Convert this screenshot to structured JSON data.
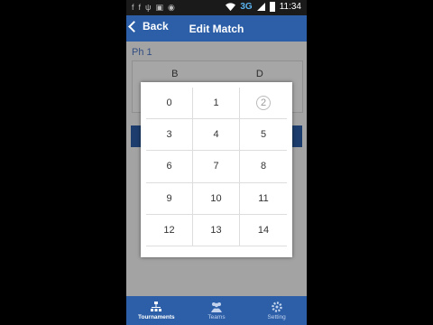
{
  "status_bar": {
    "network": "3G",
    "time": "11:34"
  },
  "header": {
    "back_label": "Back",
    "title": "Edit Match"
  },
  "background": {
    "section_label": "Ph 1",
    "team_a": "B",
    "team_b": "D"
  },
  "score_picker": {
    "options": [
      "0",
      "1",
      "2",
      "3",
      "4",
      "5",
      "6",
      "7",
      "8",
      "9",
      "10",
      "11",
      "12",
      "13",
      "14"
    ],
    "selected": "2"
  },
  "bottom_nav": {
    "items": [
      {
        "label": "Tournaments",
        "icon": "tournament-icon",
        "active": true
      },
      {
        "label": "Teams",
        "icon": "teams-icon",
        "active": false
      },
      {
        "label": "Setting",
        "icon": "gear-icon",
        "active": false
      }
    ]
  },
  "colors": {
    "brand": "#2c5fa8",
    "status_bar": "#1a1a1a"
  }
}
